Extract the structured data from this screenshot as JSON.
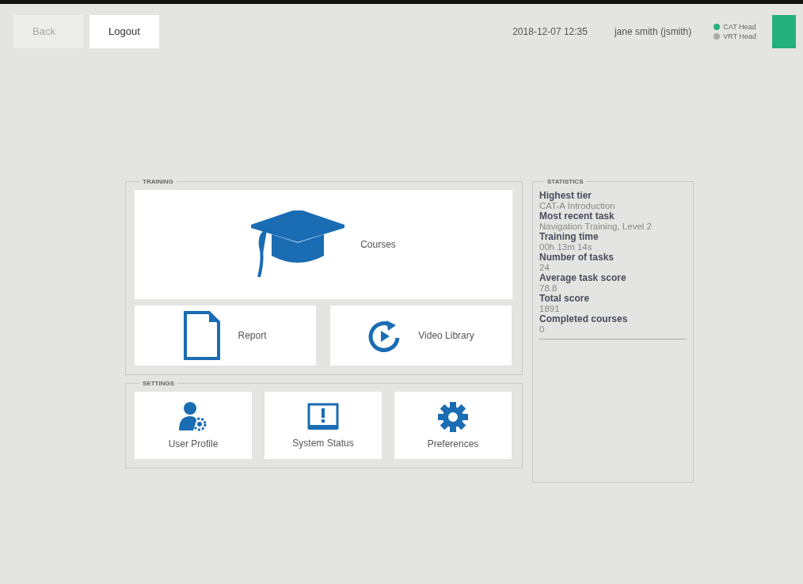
{
  "topbar": {
    "buttons": [
      {
        "label": "Back",
        "disabled": true
      },
      {
        "label": "Logout",
        "disabled": false
      }
    ],
    "datetime": "2018-12-07 12:35",
    "user": "jane smith (jsmith)",
    "heads": [
      {
        "label": "CAT Head",
        "on": true
      },
      {
        "label": "VRT Head",
        "on": false
      }
    ]
  },
  "training": {
    "title": "TRAINING",
    "tiles": [
      {
        "kind": "courses",
        "label": "Courses"
      },
      {
        "kind": "report",
        "label": "Report"
      },
      {
        "kind": "video",
        "label": "Video Library"
      }
    ]
  },
  "settings": {
    "title": "SETTINGS",
    "tiles": [
      {
        "kind": "profile",
        "label": "User Profile"
      },
      {
        "kind": "status",
        "label": "System Status"
      },
      {
        "kind": "preferences",
        "label": "Preferences"
      }
    ]
  },
  "statistics": {
    "title": "STATISTICS",
    "items": [
      {
        "label": "Highest tier",
        "value": "CAT-A Introduction"
      },
      {
        "label": "Most recent task",
        "value": "Navigation Training, Level 2"
      },
      {
        "label": "Training time",
        "value": "00h 13m 14s"
      },
      {
        "label": "Number of tasks",
        "value": "24"
      },
      {
        "label": "Average task score",
        "value": "78.8"
      },
      {
        "label": "Total score",
        "value": "1891"
      },
      {
        "label": "Completed courses",
        "value": "0"
      }
    ]
  }
}
